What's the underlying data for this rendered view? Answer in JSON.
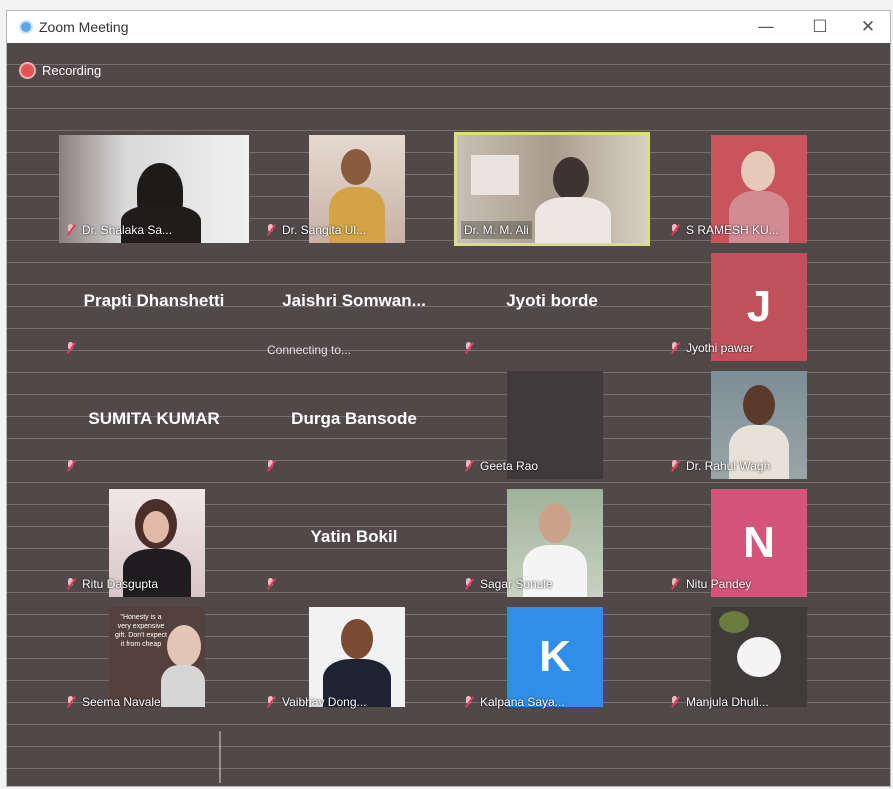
{
  "window": {
    "title": "Zoom Meeting",
    "minimize_glyph": "—",
    "maximize_glyph": "☐",
    "close_glyph": "✕"
  },
  "recording": {
    "label": "Recording"
  },
  "participants": [
    {
      "name": "Dr. Shalaka Sa..."
    },
    {
      "name": "Dr. Sangita Ul..."
    },
    {
      "name": "Dr. M. M. Ali"
    },
    {
      "name": "S RAMESH KU..."
    },
    {
      "name": "Prapti Dhanshetti"
    },
    {
      "name": "Jaishri  Somwan...",
      "status": "Connecting to..."
    },
    {
      "name": "Jyoti borde"
    },
    {
      "name": "Jyothi pawar",
      "initial": "J"
    },
    {
      "name": "SUMITA KUMAR"
    },
    {
      "name": "Durga Bansode"
    },
    {
      "name": "Geeta Rao"
    },
    {
      "name": "Dr. Rahul Wagh"
    },
    {
      "name": "Ritu Dasgupta"
    },
    {
      "name": "Yatin Bokil"
    },
    {
      "name": "Sagar Sonule"
    },
    {
      "name": "Nitu Pandey",
      "initial": "N"
    },
    {
      "name": "Seema Navale",
      "quote": "\"Honesty is a very expensive gift. Don't expect it from cheap"
    },
    {
      "name": "Vaibhav Dong..."
    },
    {
      "name": "Kalpana Saya...",
      "initial": "K"
    },
    {
      "name": "Manjula Dhuli..."
    }
  ]
}
